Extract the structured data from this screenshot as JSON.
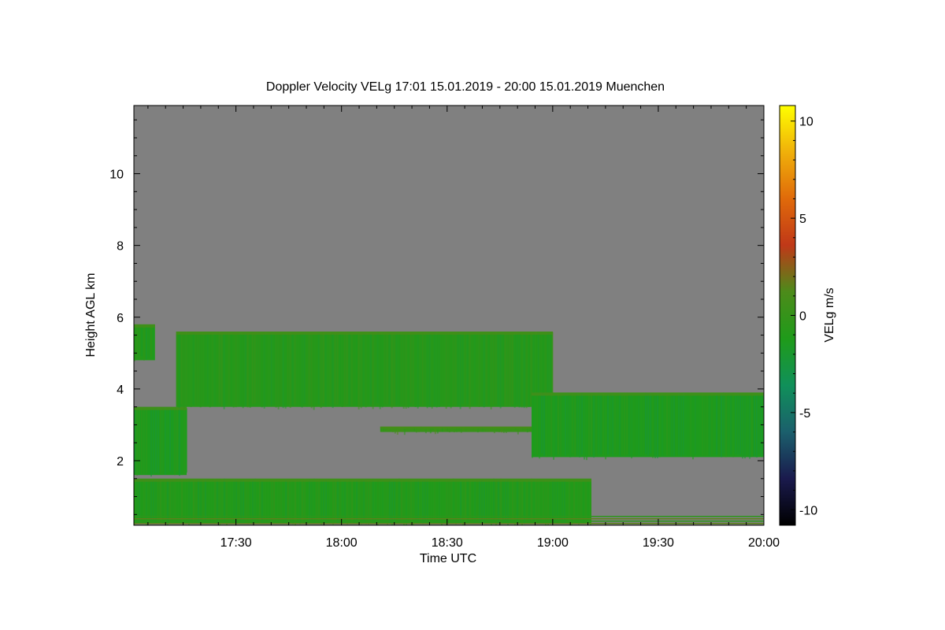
{
  "chart_data": {
    "type": "heatmap",
    "title": "Doppler Velocity VELg   17:01 15.01.2019 - 20:00 15.01.2019 Muenchen",
    "xlabel": "Time UTC",
    "ylabel": "Height AGL km",
    "colorbar_label": "VELg m/s",
    "x_range_utc": [
      "17:01",
      "20:00"
    ],
    "x_ticks": [
      "17:30",
      "18:00",
      "18:30",
      "19:00",
      "19:30",
      "20:00"
    ],
    "y_ticks": [
      "2",
      "4",
      "6",
      "8",
      "10"
    ],
    "ylim_km": [
      0.2,
      11.9
    ],
    "colorbar_ticks": [
      "10",
      "5",
      "0",
      "-5",
      "-10"
    ],
    "colorbar_range": [
      -10.8,
      10.8
    ],
    "background_color": "#808080",
    "colormap": [
      "#000000",
      "#1a1a4d",
      "#1b5f6c",
      "#10905a",
      "#1f9b1a",
      "#4c8b1a",
      "#c03818",
      "#e06a0a",
      "#f0b00a",
      "#ffff00"
    ],
    "layers": [
      {
        "name": "low cloud/precip layer",
        "mean_velocity": -1.0,
        "t_start": "17:01",
        "t_end": "19:11",
        "z_bottom_km": 0.25,
        "z_top_km": 1.5
      },
      {
        "name": "lower mid layer",
        "mean_velocity": -1.3,
        "t_start": "17:01",
        "t_end": "17:16",
        "z_bottom_km": 1.6,
        "z_top_km": 3.5
      },
      {
        "name": "mid level cloud",
        "mean_velocity": -0.8,
        "t_start": "17:13",
        "t_end": "19:00",
        "z_bottom_km": 3.5,
        "z_top_km": 5.6
      },
      {
        "name": "thin band ~2.9 km",
        "mean_velocity": 0.2,
        "t_start": "18:11",
        "t_end": "19:28",
        "z_bottom_km": 2.8,
        "z_top_km": 2.95
      },
      {
        "name": "layer 19:00-20:00",
        "mean_velocity": -1.3,
        "t_start": "18:54",
        "t_end": "20:00",
        "z_bottom_km": 2.1,
        "z_top_km": 3.9
      },
      {
        "name": "isolated echo",
        "mean_velocity": -1.0,
        "t_start": "17:01",
        "t_end": "17:07",
        "z_bottom_km": 4.8,
        "z_top_km": 5.8
      }
    ]
  }
}
